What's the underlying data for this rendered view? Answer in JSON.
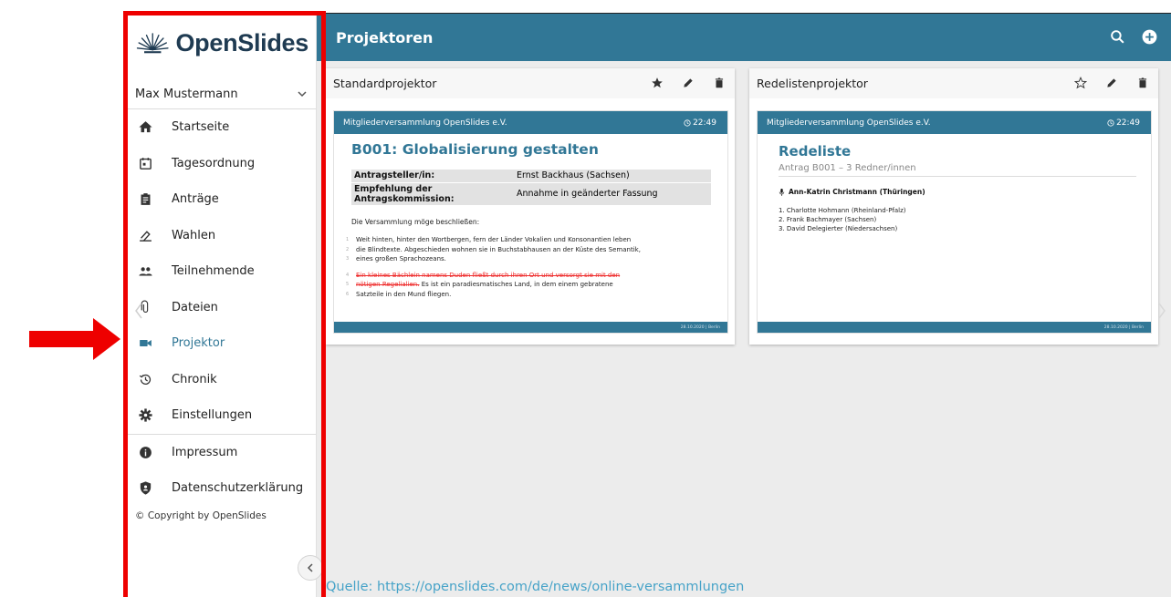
{
  "app": {
    "name": "OpenSlides"
  },
  "user": {
    "name": "Max Mustermann"
  },
  "nav": [
    {
      "label": "Startseite",
      "icon": "home-icon"
    },
    {
      "label": "Tagesordnung",
      "icon": "calendar-icon"
    },
    {
      "label": "Anträge",
      "icon": "clipboard-icon"
    },
    {
      "label": "Wahlen",
      "icon": "ballot-icon"
    },
    {
      "label": "Teilnehmende",
      "icon": "people-icon"
    },
    {
      "label": "Dateien",
      "icon": "paperclip-icon"
    },
    {
      "label": "Projektor",
      "icon": "videocam-icon",
      "active": true
    },
    {
      "label": "Chronik",
      "icon": "history-icon"
    },
    {
      "label": "Einstellungen",
      "icon": "gear-icon"
    }
  ],
  "nav_secondary": [
    {
      "label": "Impressum",
      "icon": "info-icon"
    },
    {
      "label": "Datenschutzerklärung",
      "icon": "shield-icon"
    }
  ],
  "copyright": "© Copyright by OpenSlides",
  "toolbar": {
    "title": "Projektoren"
  },
  "projectors": {
    "standard": {
      "name": "Standardprojektor",
      "header_left": "Mitgliederversammlung OpenSlides e.V.",
      "time": "22:49",
      "footer": "28.10.2020 | Berlin",
      "motion_title": "B001: Globalisierung gestalten",
      "meta": [
        {
          "key": "Antragsteller/in:",
          "value": "Ernst Backhaus (Sachsen)"
        },
        {
          "key": "Empfehlung der Antragskommission:",
          "value": "Annahme in geänderter Fassung"
        }
      ],
      "preamble": "Die Versammlung möge beschließen:",
      "lines": {
        "l1": "Weit hinten, hinter den Wortbergen, fern der Länder Vokalien und Konsonantien leben",
        "l2": "die Blindtexte. Abgeschieden wohnen sie in Buchstabhausen an der Küste des Semantik,",
        "l3": "eines großen Sprachozeans.",
        "l4_deleted": "Ein kleines Bächlein namens Duden fließt durch ihren Ort und versorgt sie mit den",
        "l5_deleted": "nötigen Regelialien.",
        "l5_rest": " Es ist ein paradiesmatisches Land, in dem einem gebratene",
        "l6": "Satzteile in den Mund fliegen."
      }
    },
    "speakers": {
      "name": "Redelistenprojektor",
      "header_left": "Mitgliederversammlung OpenSlides e.V.",
      "time": "22:49",
      "footer": "28.10.2020 | Berlin",
      "title": "Redeliste",
      "subtitle": "Antrag B001 – 3 Redner/innen",
      "current": "Ann-Katrin Christmann (Thüringen)",
      "list": [
        "1. Charlotte Hohmann (Rheinland-Pfalz)",
        "2. Frank Bachmayer (Sachsen)",
        "3. David Delegierter (Niedersachsen)"
      ]
    }
  },
  "source": "Quelle: https://openslides.com/de/news/online-versammlungen",
  "colors": {
    "primary": "#317796",
    "annotation": "#ee0000",
    "deleted": "#ee2b2b",
    "source_link": "#47a3c8"
  }
}
